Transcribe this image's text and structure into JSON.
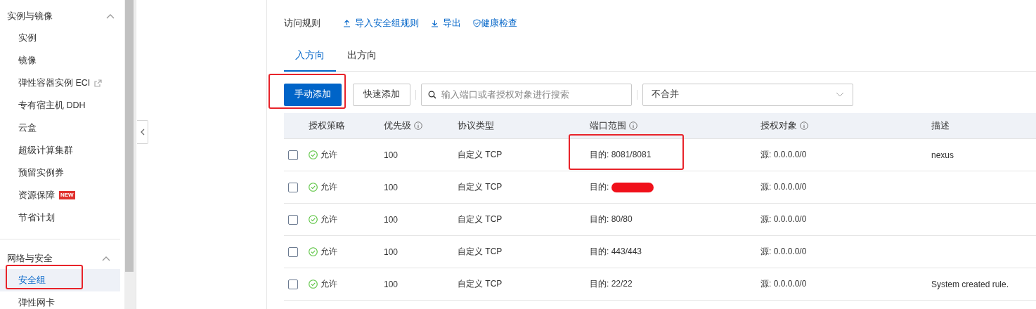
{
  "sidebar": {
    "groups": [
      {
        "title": "实例与镜像",
        "expanded": true,
        "items": [
          {
            "label": "实例",
            "selected": false,
            "highlighted": false
          },
          {
            "label": "镜像",
            "selected": false,
            "highlighted": false
          },
          {
            "label": "弹性容器实例 ECI",
            "selected": false,
            "highlighted": false,
            "external": true
          },
          {
            "label": "专有宿主机 DDH",
            "selected": false,
            "highlighted": false
          },
          {
            "label": "云盒",
            "selected": false,
            "highlighted": false
          },
          {
            "label": "超级计算集群",
            "selected": false,
            "highlighted": false
          },
          {
            "label": "预留实例券",
            "selected": false,
            "highlighted": false
          },
          {
            "label": "资源保障",
            "selected": false,
            "highlighted": false,
            "badge": "NEW"
          },
          {
            "label": "节省计划",
            "selected": false,
            "highlighted": false
          }
        ]
      },
      {
        "title": "网络与安全",
        "expanded": true,
        "items": [
          {
            "label": "安全组",
            "selected": true,
            "highlighted": true
          },
          {
            "label": "弹性网卡",
            "selected": false,
            "highlighted": false
          }
        ]
      }
    ]
  },
  "section_title": "访问规则",
  "actions": [
    {
      "label": "导入安全组规则",
      "kind": "upload"
    },
    {
      "label": "导出",
      "kind": "download"
    },
    {
      "label": "健康检查",
      "kind": "shield"
    }
  ],
  "tabs": [
    {
      "label": "入方向",
      "selected": true
    },
    {
      "label": "出方向",
      "selected": false
    }
  ],
  "toolbar": {
    "primary_button": {
      "label": "手动添加",
      "highlighted": true
    },
    "secondary_button": "快速添加",
    "search": {
      "placeholder": "输入端口或者授权对象进行搜索"
    },
    "merge_select": {
      "value": "不合并"
    }
  },
  "table": {
    "columns": [
      {
        "label": "授权策略",
        "info": false
      },
      {
        "label": "优先级",
        "info": true
      },
      {
        "label": "协议类型",
        "info": false
      },
      {
        "label": "端口范围",
        "info": true
      },
      {
        "label": "授权对象",
        "info": true
      },
      {
        "label": "描述",
        "info": false
      }
    ],
    "rows": [
      {
        "checked": false,
        "policy": "允许",
        "priority": "100",
        "protocol": "自定义 TCP",
        "port": "目的: 8081/8081",
        "port_highlighted": true,
        "port_redacted": false,
        "source": "源: 0.0.0.0/0",
        "description": "nexus"
      },
      {
        "checked": false,
        "policy": "允许",
        "priority": "100",
        "protocol": "自定义 TCP",
        "port": "目的:",
        "port_highlighted": false,
        "port_redacted": true,
        "source": "源: 0.0.0.0/0"
      },
      {
        "checked": false,
        "policy": "允许",
        "priority": "100",
        "protocol": "自定义 TCP",
        "port": "目的: 80/80",
        "port_highlighted": false,
        "port_redacted": false,
        "source": "源: 0.0.0.0/0"
      },
      {
        "checked": false,
        "policy": "允许",
        "priority": "100",
        "protocol": "自定义 TCP",
        "port": "目的: 443/443",
        "port_highlighted": false,
        "port_redacted": false,
        "source": "源: 0.0.0.0/0"
      },
      {
        "checked": false,
        "policy": "允许",
        "priority": "100",
        "protocol": "自定义 TCP",
        "port": "目的: 22/22",
        "port_highlighted": false,
        "port_redacted": false,
        "source": "源: 0.0.0.0/0",
        "description": "System created rule."
      }
    ]
  }
}
